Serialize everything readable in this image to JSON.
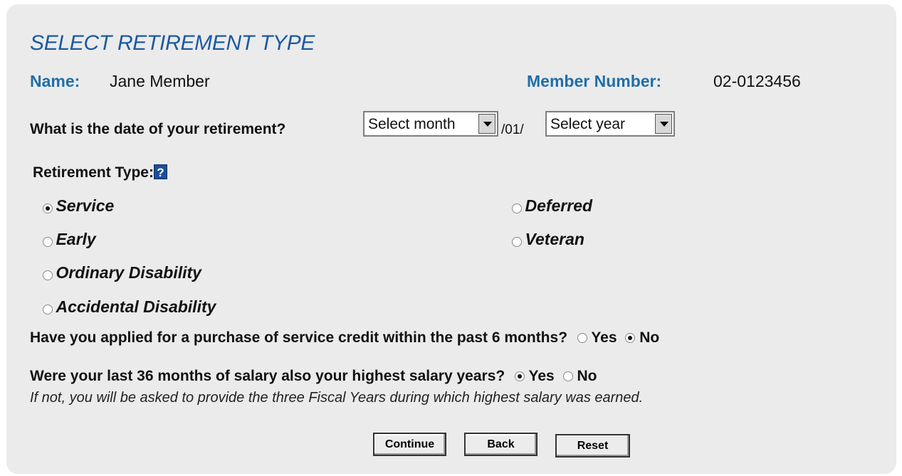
{
  "title": "SELECT RETIREMENT TYPE",
  "member": {
    "name_label": "Name:",
    "name_value": "Jane Member",
    "number_label": "Member Number:",
    "number_value": "02-0123456"
  },
  "date_question": {
    "label": "What is the date of your retirement?",
    "month_placeholder": "Select month",
    "separator": "/01/",
    "year_placeholder": "Select year"
  },
  "retirement_type": {
    "label": "Retirement Type:",
    "help_icon_text": "?",
    "options": [
      {
        "label": "Service",
        "checked": true
      },
      {
        "label": "Deferred",
        "checked": false
      },
      {
        "label": "Early",
        "checked": false
      },
      {
        "label": "Veteran",
        "checked": false
      },
      {
        "label": "Ordinary Disability",
        "checked": false
      },
      {
        "label": "Accidental Disability",
        "checked": false
      }
    ]
  },
  "purchase_question": {
    "label": "Have you applied for a purchase of service credit within the past 6 months?",
    "yes": "Yes",
    "no": "No",
    "selected": "No"
  },
  "salary_question": {
    "label": "Were your last 36 months of salary also your highest salary years?",
    "yes": "Yes",
    "no": "No",
    "selected": "Yes",
    "note": "If not, you will be asked to provide the three Fiscal Years during which highest salary was earned."
  },
  "buttons": {
    "continue": "Continue",
    "back": "Back",
    "reset": "Reset"
  }
}
